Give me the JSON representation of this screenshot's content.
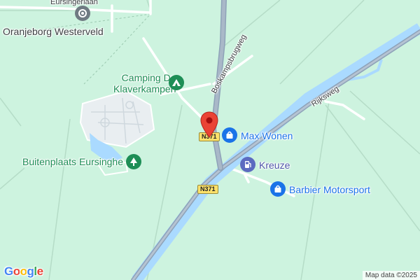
{
  "map": {
    "places": {
      "oranjeborg": "Oranjeborg Westerveld",
      "camping_line1": "Camping De",
      "camping_line2": "Klaverkampen",
      "buitenplaats": "Buitenplaats Eursinghe",
      "max_wonen": "Max Wonen",
      "kreuze": "Kreuze",
      "barbier": "Barbier Motorsport"
    },
    "roads": {
      "eursingerlaan": "Eursingerlaan",
      "boskampsbrugweg": "Boskampsbrugweg",
      "rijksweg": "Rijksweg",
      "n371_a": "N371",
      "n371_b": "N371"
    },
    "icons": {
      "oranjeborg": "cemetery-icon",
      "camping": "campground-icon",
      "buitenplaats": "tree-icon",
      "max_wonen": "shopping-bag-icon",
      "kreuze": "gas-station-icon",
      "barbier": "shopping-bag-icon",
      "marker": "location-pin-icon"
    },
    "colors": {
      "land": "#cdf3df",
      "water": "#aadaff",
      "road": "#ffffff",
      "highway": "#8ea2b8",
      "poi_green": "#1e8e56",
      "poi_blue": "#1a73e8",
      "marker": "#ea4335"
    },
    "google_logo": [
      "G",
      "o",
      "o",
      "g",
      "l",
      "e"
    ],
    "attribution": "Map data ©2025"
  }
}
